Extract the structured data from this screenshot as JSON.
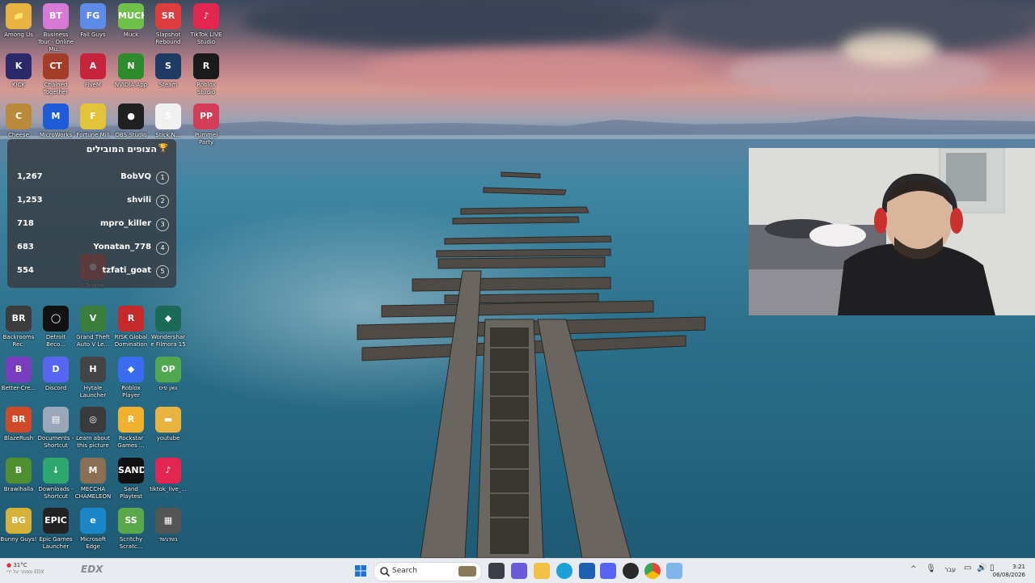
{
  "desktop": {
    "icons": [
      {
        "label": "Among Us",
        "color": "#e8b341",
        "glyph": "📁"
      },
      {
        "label": "Business Tour - Online Mu...",
        "color": "#d67ad6",
        "glyph": "BT"
      },
      {
        "label": "Fall Guys",
        "color": "#5d8ce8",
        "glyph": "FG"
      },
      {
        "label": "Muck",
        "color": "#6ec24a",
        "glyph": "MUCK"
      },
      {
        "label": "Slapshot Rebound",
        "color": "#dd3d3d",
        "glyph": "SR"
      },
      {
        "label": "TikTok LIVE Studio",
        "color": "#e3264f",
        "glyph": "♪"
      },
      {
        "label": "KICK",
        "color": "#2a2a6a",
        "glyph": "K"
      },
      {
        "label": "Chained Together",
        "color": "#a33d2a",
        "glyph": "CT"
      },
      {
        "label": "FiveM",
        "color": "#c8233c",
        "glyph": "A"
      },
      {
        "label": "NVIDIA App",
        "color": "#2d8a2d",
        "glyph": "N"
      },
      {
        "label": "Steam",
        "color": "#1d3b63",
        "glyph": "S"
      },
      {
        "label": "Roblox Studio",
        "color": "#1a1a1a",
        "glyph": "R"
      },
      {
        "label": "Cheese",
        "color": "#b98a3b",
        "glyph": "C"
      },
      {
        "label": "MicroWorks",
        "color": "#1e5bd6",
        "glyph": "M"
      },
      {
        "label": "Fortune Mill",
        "color": "#e2c33a",
        "glyph": "F"
      },
      {
        "label": "OBS Studio",
        "color": "#202020",
        "glyph": "●"
      },
      {
        "label": "Stick N...",
        "color": "#f0f0f0",
        "glyph": "S"
      },
      {
        "label": "Pummel Party",
        "color": "#d43d57",
        "glyph": "PP"
      },
      {
        "label": "Chrome",
        "color": "#d9473d",
        "glyph": "●"
      },
      {
        "label": "Backrooms Rec.",
        "color": "#3c3c3c",
        "glyph": "BR"
      },
      {
        "label": "Detroit Beco...",
        "color": "#111",
        "glyph": "◯"
      },
      {
        "label": "Grand Theft Auto V Le...",
        "color": "#3b7d3b",
        "glyph": "V"
      },
      {
        "label": "RISK Global Domination",
        "color": "#c42a2a",
        "glyph": "R"
      },
      {
        "label": "Wondershare Filmora 15",
        "color": "#1b6a58",
        "glyph": "◆"
      },
      {
        "label": "Better-Cre...",
        "color": "#7a3dbf",
        "glyph": "B"
      },
      {
        "label": "Discord",
        "color": "#5865f2",
        "glyph": "D"
      },
      {
        "label": "Hytale Launcher",
        "color": "#444",
        "glyph": "H"
      },
      {
        "label": "Roblox Player",
        "color": "#3b6bf0",
        "glyph": "◆"
      },
      {
        "label": "וואן פיס",
        "color": "#4fa84f",
        "glyph": "OP"
      },
      {
        "label": "BlazeRush",
        "color": "#d04a2a",
        "glyph": "BR"
      },
      {
        "label": "Documents - Shortcut",
        "color": "#9aa7b8",
        "glyph": "▤"
      },
      {
        "label": "Learn about this picture",
        "color": "#3a3a3a",
        "glyph": "◎"
      },
      {
        "label": "Rockstar Games ...",
        "color": "#f2b12d",
        "glyph": "R"
      },
      {
        "label": "youtube",
        "color": "#e8b341",
        "glyph": "▬"
      },
      {
        "label": "Brawlhalla",
        "color": "#4f8f2f",
        "glyph": "B"
      },
      {
        "label": "Downloads - Shortcut",
        "color": "#2fa86f",
        "glyph": "↓"
      },
      {
        "label": "MECCHA CHAMELEON",
        "color": "#8a6f55",
        "glyph": "M"
      },
      {
        "label": "Sand Playtest",
        "color": "#111",
        "glyph": "SAND"
      },
      {
        "label": "tiktok_live_...",
        "color": "#e3264f",
        "glyph": "♪"
      },
      {
        "label": "Bunny Guys!",
        "color": "#d6b23a",
        "glyph": "BG"
      },
      {
        "label": "Epic Games Launcher",
        "color": "#222",
        "glyph": "EPIC"
      },
      {
        "label": "Microsoft Edge",
        "color": "#1b86c9",
        "glyph": "e"
      },
      {
        "label": "Scritchy Scratc...",
        "color": "#5aa84a",
        "glyph": "SS"
      },
      {
        "label": "גשדגשד",
        "color": "#555",
        "glyph": "▦"
      }
    ]
  },
  "viewers_widget": {
    "title": "הצופים המובילים",
    "rows": [
      {
        "count": "1,267",
        "name": "BobVQ",
        "rank": "1"
      },
      {
        "count": "1,253",
        "name": "shvili",
        "rank": "2"
      },
      {
        "count": "718",
        "name": "mpro_killer",
        "rank": "3"
      },
      {
        "count": "683",
        "name": "Yonatan_778",
        "rank": "4"
      },
      {
        "count": "554",
        "name": "tzfati_goat",
        "rank": "5"
      }
    ]
  },
  "taskbar": {
    "search_placeholder": "Search",
    "weather": "31°C",
    "weather_sub": "מסחר על ידי EDX",
    "edx": "EDX",
    "language": "עבר",
    "time": "3:21",
    "date": "06/08/2026"
  }
}
